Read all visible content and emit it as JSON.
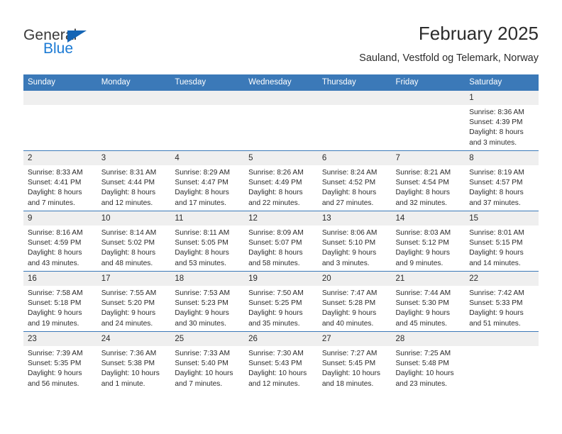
{
  "brand": {
    "name_part1": "General",
    "name_part2": "Blue"
  },
  "header": {
    "title": "February 2025",
    "subtitle": "Sauland, Vestfold og Telemark, Norway"
  },
  "colors": {
    "header_blue": "#3b79b8",
    "logo_blue": "#1b7ad4",
    "daynum_bg": "#efefef"
  },
  "weekday_headers": [
    "Sunday",
    "Monday",
    "Tuesday",
    "Wednesday",
    "Thursday",
    "Friday",
    "Saturday"
  ],
  "weeks": [
    [
      {
        "day": "",
        "sunrise": "",
        "sunset": "",
        "daylight1": "",
        "daylight2": ""
      },
      {
        "day": "",
        "sunrise": "",
        "sunset": "",
        "daylight1": "",
        "daylight2": ""
      },
      {
        "day": "",
        "sunrise": "",
        "sunset": "",
        "daylight1": "",
        "daylight2": ""
      },
      {
        "day": "",
        "sunrise": "",
        "sunset": "",
        "daylight1": "",
        "daylight2": ""
      },
      {
        "day": "",
        "sunrise": "",
        "sunset": "",
        "daylight1": "",
        "daylight2": ""
      },
      {
        "day": "",
        "sunrise": "",
        "sunset": "",
        "daylight1": "",
        "daylight2": ""
      },
      {
        "day": "1",
        "sunrise": "Sunrise: 8:36 AM",
        "sunset": "Sunset: 4:39 PM",
        "daylight1": "Daylight: 8 hours",
        "daylight2": "and 3 minutes."
      }
    ],
    [
      {
        "day": "2",
        "sunrise": "Sunrise: 8:33 AM",
        "sunset": "Sunset: 4:41 PM",
        "daylight1": "Daylight: 8 hours",
        "daylight2": "and 7 minutes."
      },
      {
        "day": "3",
        "sunrise": "Sunrise: 8:31 AM",
        "sunset": "Sunset: 4:44 PM",
        "daylight1": "Daylight: 8 hours",
        "daylight2": "and 12 minutes."
      },
      {
        "day": "4",
        "sunrise": "Sunrise: 8:29 AM",
        "sunset": "Sunset: 4:47 PM",
        "daylight1": "Daylight: 8 hours",
        "daylight2": "and 17 minutes."
      },
      {
        "day": "5",
        "sunrise": "Sunrise: 8:26 AM",
        "sunset": "Sunset: 4:49 PM",
        "daylight1": "Daylight: 8 hours",
        "daylight2": "and 22 minutes."
      },
      {
        "day": "6",
        "sunrise": "Sunrise: 8:24 AM",
        "sunset": "Sunset: 4:52 PM",
        "daylight1": "Daylight: 8 hours",
        "daylight2": "and 27 minutes."
      },
      {
        "day": "7",
        "sunrise": "Sunrise: 8:21 AM",
        "sunset": "Sunset: 4:54 PM",
        "daylight1": "Daylight: 8 hours",
        "daylight2": "and 32 minutes."
      },
      {
        "day": "8",
        "sunrise": "Sunrise: 8:19 AM",
        "sunset": "Sunset: 4:57 PM",
        "daylight1": "Daylight: 8 hours",
        "daylight2": "and 37 minutes."
      }
    ],
    [
      {
        "day": "9",
        "sunrise": "Sunrise: 8:16 AM",
        "sunset": "Sunset: 4:59 PM",
        "daylight1": "Daylight: 8 hours",
        "daylight2": "and 43 minutes."
      },
      {
        "day": "10",
        "sunrise": "Sunrise: 8:14 AM",
        "sunset": "Sunset: 5:02 PM",
        "daylight1": "Daylight: 8 hours",
        "daylight2": "and 48 minutes."
      },
      {
        "day": "11",
        "sunrise": "Sunrise: 8:11 AM",
        "sunset": "Sunset: 5:05 PM",
        "daylight1": "Daylight: 8 hours",
        "daylight2": "and 53 minutes."
      },
      {
        "day": "12",
        "sunrise": "Sunrise: 8:09 AM",
        "sunset": "Sunset: 5:07 PM",
        "daylight1": "Daylight: 8 hours",
        "daylight2": "and 58 minutes."
      },
      {
        "day": "13",
        "sunrise": "Sunrise: 8:06 AM",
        "sunset": "Sunset: 5:10 PM",
        "daylight1": "Daylight: 9 hours",
        "daylight2": "and 3 minutes."
      },
      {
        "day": "14",
        "sunrise": "Sunrise: 8:03 AM",
        "sunset": "Sunset: 5:12 PM",
        "daylight1": "Daylight: 9 hours",
        "daylight2": "and 9 minutes."
      },
      {
        "day": "15",
        "sunrise": "Sunrise: 8:01 AM",
        "sunset": "Sunset: 5:15 PM",
        "daylight1": "Daylight: 9 hours",
        "daylight2": "and 14 minutes."
      }
    ],
    [
      {
        "day": "16",
        "sunrise": "Sunrise: 7:58 AM",
        "sunset": "Sunset: 5:18 PM",
        "daylight1": "Daylight: 9 hours",
        "daylight2": "and 19 minutes."
      },
      {
        "day": "17",
        "sunrise": "Sunrise: 7:55 AM",
        "sunset": "Sunset: 5:20 PM",
        "daylight1": "Daylight: 9 hours",
        "daylight2": "and 24 minutes."
      },
      {
        "day": "18",
        "sunrise": "Sunrise: 7:53 AM",
        "sunset": "Sunset: 5:23 PM",
        "daylight1": "Daylight: 9 hours",
        "daylight2": "and 30 minutes."
      },
      {
        "day": "19",
        "sunrise": "Sunrise: 7:50 AM",
        "sunset": "Sunset: 5:25 PM",
        "daylight1": "Daylight: 9 hours",
        "daylight2": "and 35 minutes."
      },
      {
        "day": "20",
        "sunrise": "Sunrise: 7:47 AM",
        "sunset": "Sunset: 5:28 PM",
        "daylight1": "Daylight: 9 hours",
        "daylight2": "and 40 minutes."
      },
      {
        "day": "21",
        "sunrise": "Sunrise: 7:44 AM",
        "sunset": "Sunset: 5:30 PM",
        "daylight1": "Daylight: 9 hours",
        "daylight2": "and 45 minutes."
      },
      {
        "day": "22",
        "sunrise": "Sunrise: 7:42 AM",
        "sunset": "Sunset: 5:33 PM",
        "daylight1": "Daylight: 9 hours",
        "daylight2": "and 51 minutes."
      }
    ],
    [
      {
        "day": "23",
        "sunrise": "Sunrise: 7:39 AM",
        "sunset": "Sunset: 5:35 PM",
        "daylight1": "Daylight: 9 hours",
        "daylight2": "and 56 minutes."
      },
      {
        "day": "24",
        "sunrise": "Sunrise: 7:36 AM",
        "sunset": "Sunset: 5:38 PM",
        "daylight1": "Daylight: 10 hours",
        "daylight2": "and 1 minute."
      },
      {
        "day": "25",
        "sunrise": "Sunrise: 7:33 AM",
        "sunset": "Sunset: 5:40 PM",
        "daylight1": "Daylight: 10 hours",
        "daylight2": "and 7 minutes."
      },
      {
        "day": "26",
        "sunrise": "Sunrise: 7:30 AM",
        "sunset": "Sunset: 5:43 PM",
        "daylight1": "Daylight: 10 hours",
        "daylight2": "and 12 minutes."
      },
      {
        "day": "27",
        "sunrise": "Sunrise: 7:27 AM",
        "sunset": "Sunset: 5:45 PM",
        "daylight1": "Daylight: 10 hours",
        "daylight2": "and 18 minutes."
      },
      {
        "day": "28",
        "sunrise": "Sunrise: 7:25 AM",
        "sunset": "Sunset: 5:48 PM",
        "daylight1": "Daylight: 10 hours",
        "daylight2": "and 23 minutes."
      },
      {
        "day": "",
        "sunrise": "",
        "sunset": "",
        "daylight1": "",
        "daylight2": ""
      }
    ]
  ]
}
